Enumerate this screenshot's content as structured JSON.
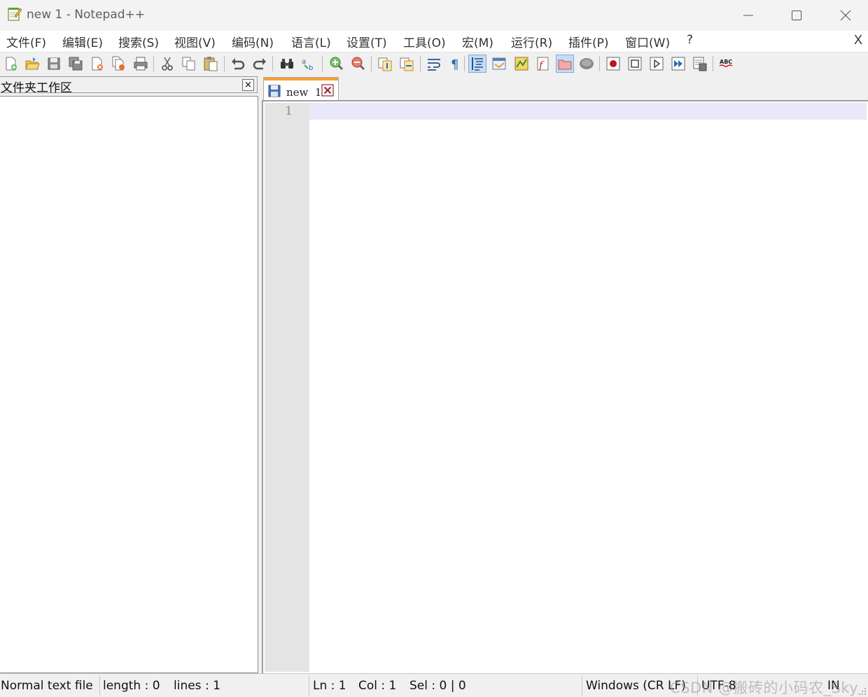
{
  "window": {
    "title": "new 1 - Notepad++",
    "controls": [
      "minimize-icon",
      "maximize-icon",
      "close-icon"
    ]
  },
  "menubar": {
    "items": [
      "文件(F)",
      "编辑(E)",
      "搜索(S)",
      "视图(V)",
      "编码(N)",
      "语言(L)",
      "设置(T)",
      "工具(O)",
      "宏(M)",
      "运行(R)",
      "插件(P)",
      "窗口(W)",
      "?"
    ],
    "close_doc": "X"
  },
  "toolbar": {
    "buttons": [
      "new-file-icon",
      "open-file-icon",
      "save-icon",
      "save-all-icon",
      "close-icon",
      "close-all-icon",
      "print-icon",
      "cut-icon",
      "copy-icon",
      "paste-icon",
      "undo-icon",
      "redo-icon",
      "find-icon",
      "replace-icon",
      "zoom-in-icon",
      "zoom-out-icon",
      "sync-vertical-icon",
      "sync-horizontal-icon",
      "word-wrap-icon",
      "show-all-characters-icon",
      "indent-guide-icon",
      "user-defined-language-icon",
      "document-map-icon",
      "function-list-icon",
      "folder-workspace-icon",
      "monitoring-icon",
      "record-macro-icon",
      "stop-recording-icon",
      "playback-macro-icon",
      "run-macro-multiple-icon",
      "save-macro-icon",
      "spell-check-icon"
    ],
    "active": [
      "indent-guide-icon",
      "folder-workspace-icon"
    ]
  },
  "folder_panel": {
    "title": "文件夹工作区",
    "close": "×"
  },
  "tabs": [
    {
      "label": "new  1",
      "active": true
    }
  ],
  "editor": {
    "line_numbers": [
      "1"
    ],
    "content": ""
  },
  "statusbar": {
    "file_type": "Normal text file",
    "length": "length : 0",
    "lines": "lines : 1",
    "ln": "Ln : 1",
    "col": "Col : 1",
    "sel": "Sel : 0 | 0",
    "eol": "Windows (CR LF)",
    "encoding": "UTF-8",
    "mode": "IN",
    "watermark": "CSDN @搬砖的小码农_Sky"
  },
  "colors": {
    "tab_accent": "#f7a134",
    "current_line": "#e8e8fa",
    "gutter": "#e4e4e4",
    "active_tool": "#c6dcf5"
  }
}
